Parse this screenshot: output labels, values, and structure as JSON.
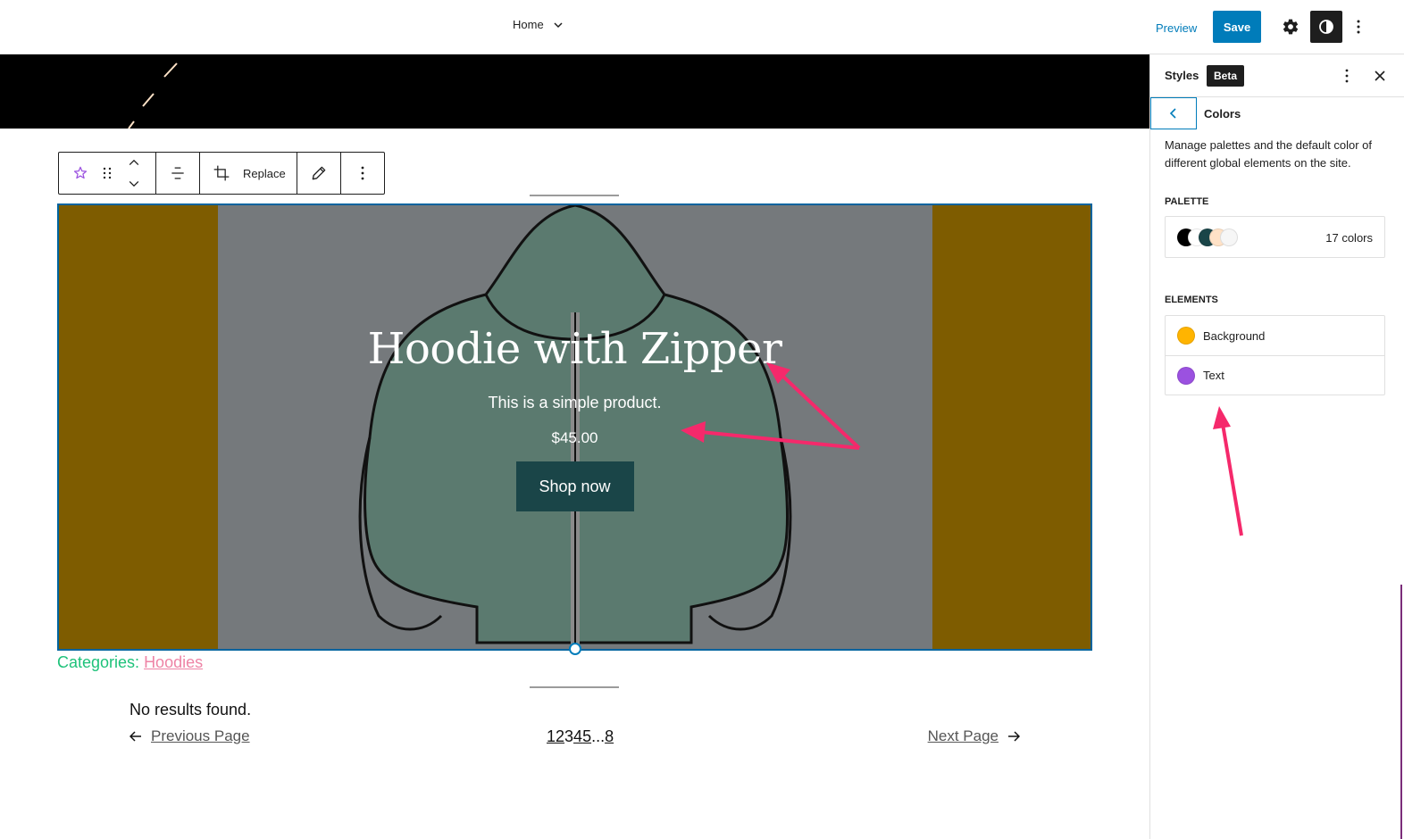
{
  "topbar": {
    "document_title": "Home",
    "preview_label": "Preview",
    "save_label": "Save",
    "accent_color": "#007cba"
  },
  "block_toolbar": {
    "replace_label": "Replace"
  },
  "cover": {
    "title": "Hoodie with Zipper",
    "description": "This is a simple product.",
    "price": "$45.00",
    "button_label": "Shop now",
    "overlay_color": "#7e5c00",
    "button_color": "#1a4548"
  },
  "post_meta": {
    "categories_label": "Categories: ",
    "category_link": "Hoodies"
  },
  "query": {
    "no_results": "No results found.",
    "previous_label": "Previous Page",
    "next_label": "Next Page",
    "pages": [
      "1",
      "2",
      "3",
      "4",
      "5",
      "...",
      "8"
    ],
    "current_page": "3"
  },
  "sidebar": {
    "title": "Styles",
    "badge": "Beta",
    "panel_title": "Colors",
    "description": "Manage palettes and the default color of different global elements on the site.",
    "palette_label": "Palette",
    "palette_count": "17 colors",
    "palette_swatches": [
      "#000000",
      "#ffffff",
      "#1a4548",
      "#ffe2c7",
      "#f6f6f6"
    ],
    "elements_label": "Elements",
    "elements": [
      {
        "label": "Background",
        "color": "#ffb400"
      },
      {
        "label": "Text",
        "color": "#9b51e0"
      }
    ]
  }
}
